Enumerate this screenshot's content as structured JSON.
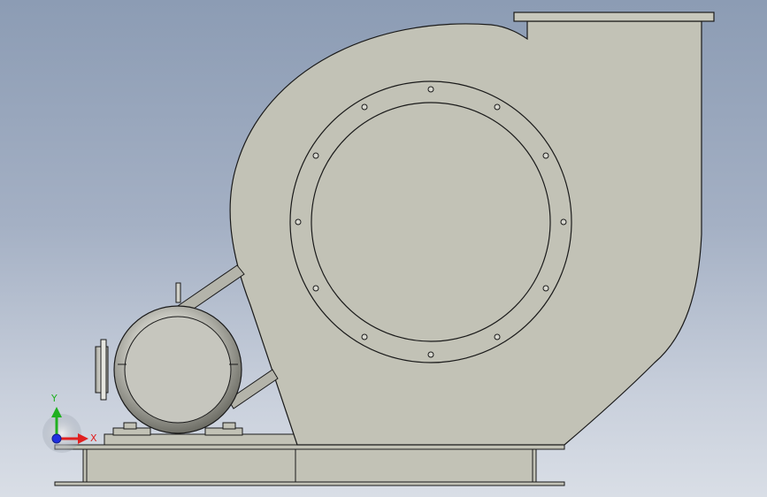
{
  "axes": {
    "x_label": "X",
    "y_label": "Y",
    "colors": {
      "x": "#e02020",
      "y": "#20b020",
      "z": "#2030e0"
    }
  },
  "model": {
    "body_color": "#c2c2b6",
    "edge_color": "#1a1a1a",
    "metal_highlight": "#f2f2ee",
    "metal_shadow": "#7a7a72"
  },
  "icons": {
    "triad": "triad-icon",
    "x_arrow": "x-arrow-icon",
    "y_arrow": "y-arrow-icon",
    "z_origin": "z-origin-icon"
  }
}
